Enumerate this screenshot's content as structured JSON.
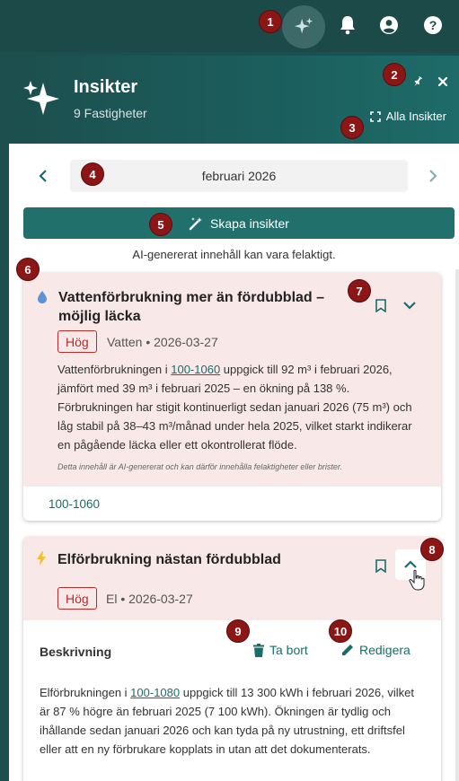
{
  "panel": {
    "title": "Insikter",
    "subtitle": "9 Fastigheter",
    "all_insights_label": "Alla Insikter"
  },
  "period": {
    "month": "februari 2026"
  },
  "create_button": {
    "label": "Skapa insikter"
  },
  "disclaimer": "AI-genererat innehåll kan vara felaktigt.",
  "cards": [
    {
      "title_line1": "Vattenförbrukning mer än fördubblad –",
      "title_line2": "möjlig läcka",
      "severity": "Hög",
      "meta": "Vatten • 2026-03-27",
      "text_before_link": "Vattenförbrukningen i ",
      "link": "100-1060",
      "text_after_link": " uppgick till 92 m³ i februari 2026, jämfört med 39 m³ i februari 2025 – en ökning på 138 %. Förbrukningen har stigit kontinuerligt sedan januari 2026 (75 m³) och låg stabil på 38–43 m³/månad under hela 2025, vilket starkt indikerar en pågående läcka eller ett okontrollerat flöde.",
      "ai_note": "Detta innehåll är AI-genererat och kan därför innehålla felaktigheter eller brister.",
      "property": "100-1060"
    },
    {
      "title": "Elförbrukning nästan fördubblad",
      "severity": "Hög",
      "meta": "El • 2026-03-27",
      "section_label": "Beskrivning",
      "delete_label": "Ta bort",
      "edit_label": "Redigera",
      "text_before_link": "Elförbrukningen i ",
      "link": "100-1080",
      "text_after_link": " uppgick till 13 300 kWh i februari 2026, vilket är 87 % högre än februari 2025 (7 100 kWh). Ökningen är tydlig och ihållande sedan januari 2026 och kan tyda på ny utrustning, ett driftsfel eller att en ny förbrukare kopplats in utan att det dokumenterats."
    }
  ],
  "markers": [
    "1",
    "2",
    "3",
    "4",
    "5",
    "6",
    "7",
    "8",
    "9",
    "10"
  ],
  "colors": {
    "accent": "#22706c",
    "header": "#1c4a49",
    "alert_bg": "#f9e8e8",
    "severity": "#b92c2c"
  }
}
